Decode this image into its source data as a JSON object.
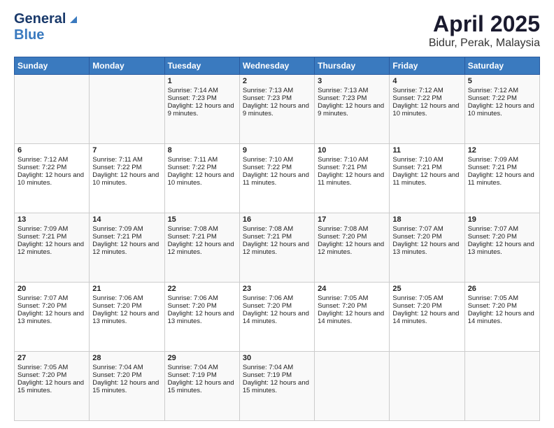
{
  "header": {
    "logo_general": "General",
    "logo_blue": "Blue",
    "title": "April 2025",
    "subtitle": "Bidur, Perak, Malaysia"
  },
  "days_of_week": [
    "Sunday",
    "Monday",
    "Tuesday",
    "Wednesday",
    "Thursday",
    "Friday",
    "Saturday"
  ],
  "weeks": [
    [
      {
        "day": "",
        "sunrise": "",
        "sunset": "",
        "daylight": ""
      },
      {
        "day": "",
        "sunrise": "",
        "sunset": "",
        "daylight": ""
      },
      {
        "day": "1",
        "sunrise": "Sunrise: 7:14 AM",
        "sunset": "Sunset: 7:23 PM",
        "daylight": "Daylight: 12 hours and 9 minutes."
      },
      {
        "day": "2",
        "sunrise": "Sunrise: 7:13 AM",
        "sunset": "Sunset: 7:23 PM",
        "daylight": "Daylight: 12 hours and 9 minutes."
      },
      {
        "day": "3",
        "sunrise": "Sunrise: 7:13 AM",
        "sunset": "Sunset: 7:23 PM",
        "daylight": "Daylight: 12 hours and 9 minutes."
      },
      {
        "day": "4",
        "sunrise": "Sunrise: 7:12 AM",
        "sunset": "Sunset: 7:22 PM",
        "daylight": "Daylight: 12 hours and 10 minutes."
      },
      {
        "day": "5",
        "sunrise": "Sunrise: 7:12 AM",
        "sunset": "Sunset: 7:22 PM",
        "daylight": "Daylight: 12 hours and 10 minutes."
      }
    ],
    [
      {
        "day": "6",
        "sunrise": "Sunrise: 7:12 AM",
        "sunset": "Sunset: 7:22 PM",
        "daylight": "Daylight: 12 hours and 10 minutes."
      },
      {
        "day": "7",
        "sunrise": "Sunrise: 7:11 AM",
        "sunset": "Sunset: 7:22 PM",
        "daylight": "Daylight: 12 hours and 10 minutes."
      },
      {
        "day": "8",
        "sunrise": "Sunrise: 7:11 AM",
        "sunset": "Sunset: 7:22 PM",
        "daylight": "Daylight: 12 hours and 10 minutes."
      },
      {
        "day": "9",
        "sunrise": "Sunrise: 7:10 AM",
        "sunset": "Sunset: 7:22 PM",
        "daylight": "Daylight: 12 hours and 11 minutes."
      },
      {
        "day": "10",
        "sunrise": "Sunrise: 7:10 AM",
        "sunset": "Sunset: 7:21 PM",
        "daylight": "Daylight: 12 hours and 11 minutes."
      },
      {
        "day": "11",
        "sunrise": "Sunrise: 7:10 AM",
        "sunset": "Sunset: 7:21 PM",
        "daylight": "Daylight: 12 hours and 11 minutes."
      },
      {
        "day": "12",
        "sunrise": "Sunrise: 7:09 AM",
        "sunset": "Sunset: 7:21 PM",
        "daylight": "Daylight: 12 hours and 11 minutes."
      }
    ],
    [
      {
        "day": "13",
        "sunrise": "Sunrise: 7:09 AM",
        "sunset": "Sunset: 7:21 PM",
        "daylight": "Daylight: 12 hours and 12 minutes."
      },
      {
        "day": "14",
        "sunrise": "Sunrise: 7:09 AM",
        "sunset": "Sunset: 7:21 PM",
        "daylight": "Daylight: 12 hours and 12 minutes."
      },
      {
        "day": "15",
        "sunrise": "Sunrise: 7:08 AM",
        "sunset": "Sunset: 7:21 PM",
        "daylight": "Daylight: 12 hours and 12 minutes."
      },
      {
        "day": "16",
        "sunrise": "Sunrise: 7:08 AM",
        "sunset": "Sunset: 7:21 PM",
        "daylight": "Daylight: 12 hours and 12 minutes."
      },
      {
        "day": "17",
        "sunrise": "Sunrise: 7:08 AM",
        "sunset": "Sunset: 7:20 PM",
        "daylight": "Daylight: 12 hours and 12 minutes."
      },
      {
        "day": "18",
        "sunrise": "Sunrise: 7:07 AM",
        "sunset": "Sunset: 7:20 PM",
        "daylight": "Daylight: 12 hours and 13 minutes."
      },
      {
        "day": "19",
        "sunrise": "Sunrise: 7:07 AM",
        "sunset": "Sunset: 7:20 PM",
        "daylight": "Daylight: 12 hours and 13 minutes."
      }
    ],
    [
      {
        "day": "20",
        "sunrise": "Sunrise: 7:07 AM",
        "sunset": "Sunset: 7:20 PM",
        "daylight": "Daylight: 12 hours and 13 minutes."
      },
      {
        "day": "21",
        "sunrise": "Sunrise: 7:06 AM",
        "sunset": "Sunset: 7:20 PM",
        "daylight": "Daylight: 12 hours and 13 minutes."
      },
      {
        "day": "22",
        "sunrise": "Sunrise: 7:06 AM",
        "sunset": "Sunset: 7:20 PM",
        "daylight": "Daylight: 12 hours and 13 minutes."
      },
      {
        "day": "23",
        "sunrise": "Sunrise: 7:06 AM",
        "sunset": "Sunset: 7:20 PM",
        "daylight": "Daylight: 12 hours and 14 minutes."
      },
      {
        "day": "24",
        "sunrise": "Sunrise: 7:05 AM",
        "sunset": "Sunset: 7:20 PM",
        "daylight": "Daylight: 12 hours and 14 minutes."
      },
      {
        "day": "25",
        "sunrise": "Sunrise: 7:05 AM",
        "sunset": "Sunset: 7:20 PM",
        "daylight": "Daylight: 12 hours and 14 minutes."
      },
      {
        "day": "26",
        "sunrise": "Sunrise: 7:05 AM",
        "sunset": "Sunset: 7:20 PM",
        "daylight": "Daylight: 12 hours and 14 minutes."
      }
    ],
    [
      {
        "day": "27",
        "sunrise": "Sunrise: 7:05 AM",
        "sunset": "Sunset: 7:20 PM",
        "daylight": "Daylight: 12 hours and 15 minutes."
      },
      {
        "day": "28",
        "sunrise": "Sunrise: 7:04 AM",
        "sunset": "Sunset: 7:20 PM",
        "daylight": "Daylight: 12 hours and 15 minutes."
      },
      {
        "day": "29",
        "sunrise": "Sunrise: 7:04 AM",
        "sunset": "Sunset: 7:19 PM",
        "daylight": "Daylight: 12 hours and 15 minutes."
      },
      {
        "day": "30",
        "sunrise": "Sunrise: 7:04 AM",
        "sunset": "Sunset: 7:19 PM",
        "daylight": "Daylight: 12 hours and 15 minutes."
      },
      {
        "day": "",
        "sunrise": "",
        "sunset": "",
        "daylight": ""
      },
      {
        "day": "",
        "sunrise": "",
        "sunset": "",
        "daylight": ""
      },
      {
        "day": "",
        "sunrise": "",
        "sunset": "",
        "daylight": ""
      }
    ]
  ]
}
